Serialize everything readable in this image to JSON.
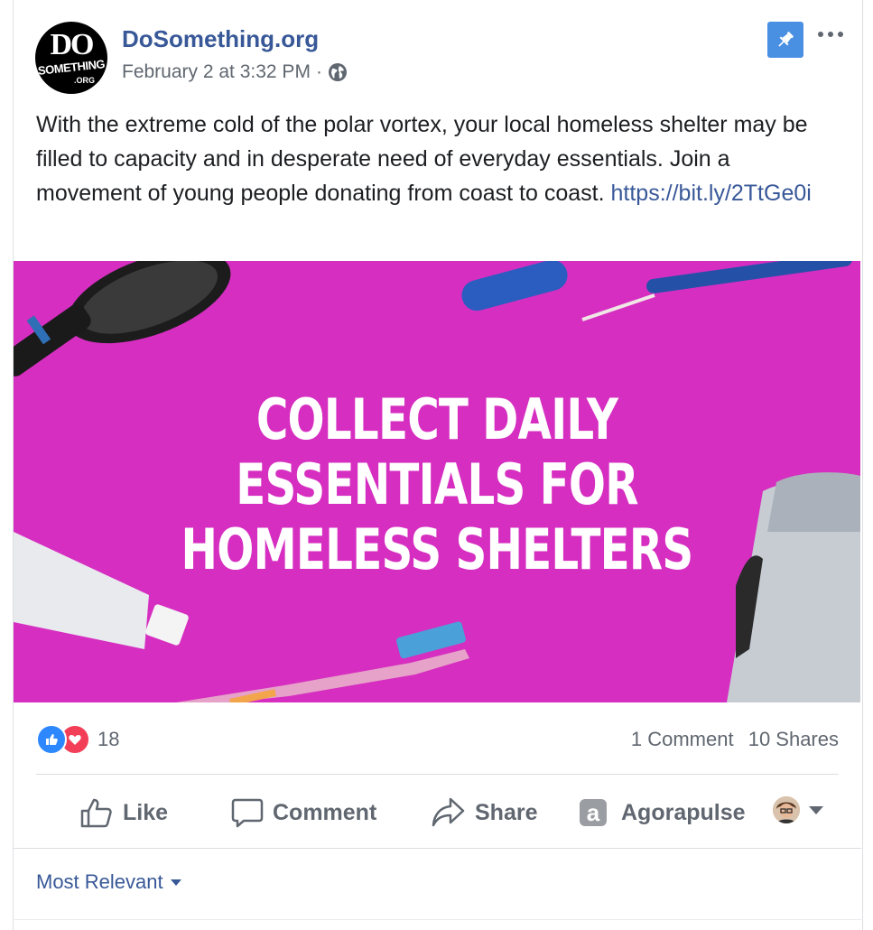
{
  "post": {
    "page_name": "DoSomething.org",
    "avatar": {
      "line1": "DO",
      "line2": "SOMETHING",
      "line3": ".ORG"
    },
    "timestamp": "February 2 at 3:32 PM",
    "separator": "·",
    "privacy_icon": "globe-icon",
    "body_text": "With the extreme cold of the polar vortex, your local homeless shelter may be filled to capacity and in desperate need of everyday essentials. Join a movement of young people donating from coast to coast. ",
    "link_text": "https://bit.ly/2TtGe0i",
    "image": {
      "headline_line1": "COLLECT DAILY",
      "headline_line2": "ESSENTIALS FOR",
      "headline_line3": "HOMELESS SHELTERS",
      "background_color": "#d62ec0"
    }
  },
  "header_actions": {
    "pin_icon": "pushpin-icon",
    "more_icon": "more-dots-icon",
    "pin_color": "#4a90e2"
  },
  "engagement": {
    "reaction_count": "18",
    "reactions": [
      "like-icon",
      "love-icon"
    ],
    "comments": "1 Comment",
    "shares": "10 Shares"
  },
  "actions": {
    "like": "Like",
    "comment": "Comment",
    "share": "Share",
    "agorapulse": "Agorapulse",
    "agorapulse_glyph": "a"
  },
  "comments": {
    "sort_label": "Most Relevant"
  },
  "colors": {
    "link": "#385898",
    "text": "#1c1e21",
    "muted": "#606770",
    "like_blue": "#2d88ff",
    "love_red": "#f33e58"
  }
}
